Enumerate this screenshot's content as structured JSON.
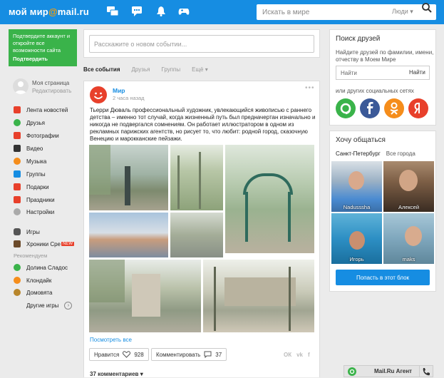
{
  "header": {
    "logo_text": "мой мир",
    "logo_at": "@",
    "logo_mail": "mail.ru",
    "search_placeholder": "Искать в мире",
    "search_scope": "Люди",
    "icons": [
      "messages-icon",
      "chat-icon",
      "notifications-bell-icon",
      "games-gamepad-icon",
      "search-icon"
    ]
  },
  "promo": {
    "text": "Подтвердите аккаунт и откройте все возможности сайта",
    "button": "Подтвердить"
  },
  "profile": {
    "name": "Моя страница",
    "edit": "Редактировать"
  },
  "nav": {
    "items": [
      {
        "label": "Лента новостей",
        "icon": "news-feed-icon",
        "color": "#e8402b"
      },
      {
        "label": "Друзья",
        "icon": "friends-icon",
        "color": "#3ab34a"
      },
      {
        "label": "Фотографии",
        "icon": "photos-icon",
        "color": "#e8402b"
      },
      {
        "label": "Видео",
        "icon": "video-icon",
        "color": "#333333"
      },
      {
        "label": "Музыка",
        "icon": "music-icon",
        "color": "#f58d1b"
      },
      {
        "label": "Группы",
        "icon": "groups-icon",
        "color": "#168de2"
      },
      {
        "label": "Подарки",
        "icon": "gifts-icon",
        "color": "#e8402b"
      },
      {
        "label": "Праздники",
        "icon": "holidays-icon",
        "color": "#e8402b"
      },
      {
        "label": "Настройки",
        "icon": "settings-gear-icon",
        "color": "#aaaaaa"
      }
    ],
    "games": "Игры",
    "chronicles": "Хроники Сре",
    "new_badge": "NEW",
    "recommended_label": "Рекомендуем",
    "recommended": [
      {
        "label": "Долина Сладос",
        "icon": "candy-valley-icon"
      },
      {
        "label": "Клондайк",
        "icon": "klondike-icon"
      },
      {
        "label": "Домовята",
        "icon": "domovyata-icon"
      }
    ],
    "other_games": "Другие игры"
  },
  "composer": {
    "placeholder": "Расскажите о новом событии..."
  },
  "feed_tabs": {
    "all": "Все события",
    "friends": "Друзья",
    "groups": "Группы",
    "more": "Ещё"
  },
  "post": {
    "author": "Мир",
    "time": "2 часа назад",
    "text": "Тьерри Дюваль профессиональный художник, увлекающийся живописью с раннего детства – именно тот случай, когда жизненный путь был предначертан изначально и никогда не подвергался сомнениям. Он работает иллюстратором в одном из рекламных парижских агентств, но рисует то, что любит: родной город, сказочную Венецию и марокканские пейзажи.",
    "view_all": "Посмотреть все",
    "like_label": "Нравится",
    "like_count": "928",
    "comment_label": "Комментировать",
    "comment_count": "37",
    "comments_toggle": "37 комментариев",
    "share": [
      "ok-share-icon",
      "vk-share-icon",
      "fb-share-icon"
    ]
  },
  "friends_panel": {
    "title": "Поиск друзей",
    "desc": "Найдите друзей по фамилии, имени, отчеству в Моем Мире",
    "input_placeholder": "Найти",
    "find_button": "Найти",
    "social_label": "или других социальных сетях",
    "social": [
      {
        "name": "mail-ru-agent-icon",
        "color": "#3ab34a"
      },
      {
        "name": "facebook-icon",
        "color": "#3b5998"
      },
      {
        "name": "odnoklassniki-icon",
        "color": "#f58d1b"
      },
      {
        "name": "yandex-icon",
        "color": "#e8402b"
      }
    ]
  },
  "chat_panel": {
    "title": "Хочу общаться",
    "tab_city": "Санкт-Петербург",
    "tab_all": "Все города",
    "people": [
      {
        "name": "Nadusssha"
      },
      {
        "name": "Алексей"
      },
      {
        "name": "Игорь"
      },
      {
        "name": "maks"
      }
    ],
    "join_button": "Попасть в этот блок"
  },
  "agent": {
    "label": "Mail.Ru Агент"
  }
}
